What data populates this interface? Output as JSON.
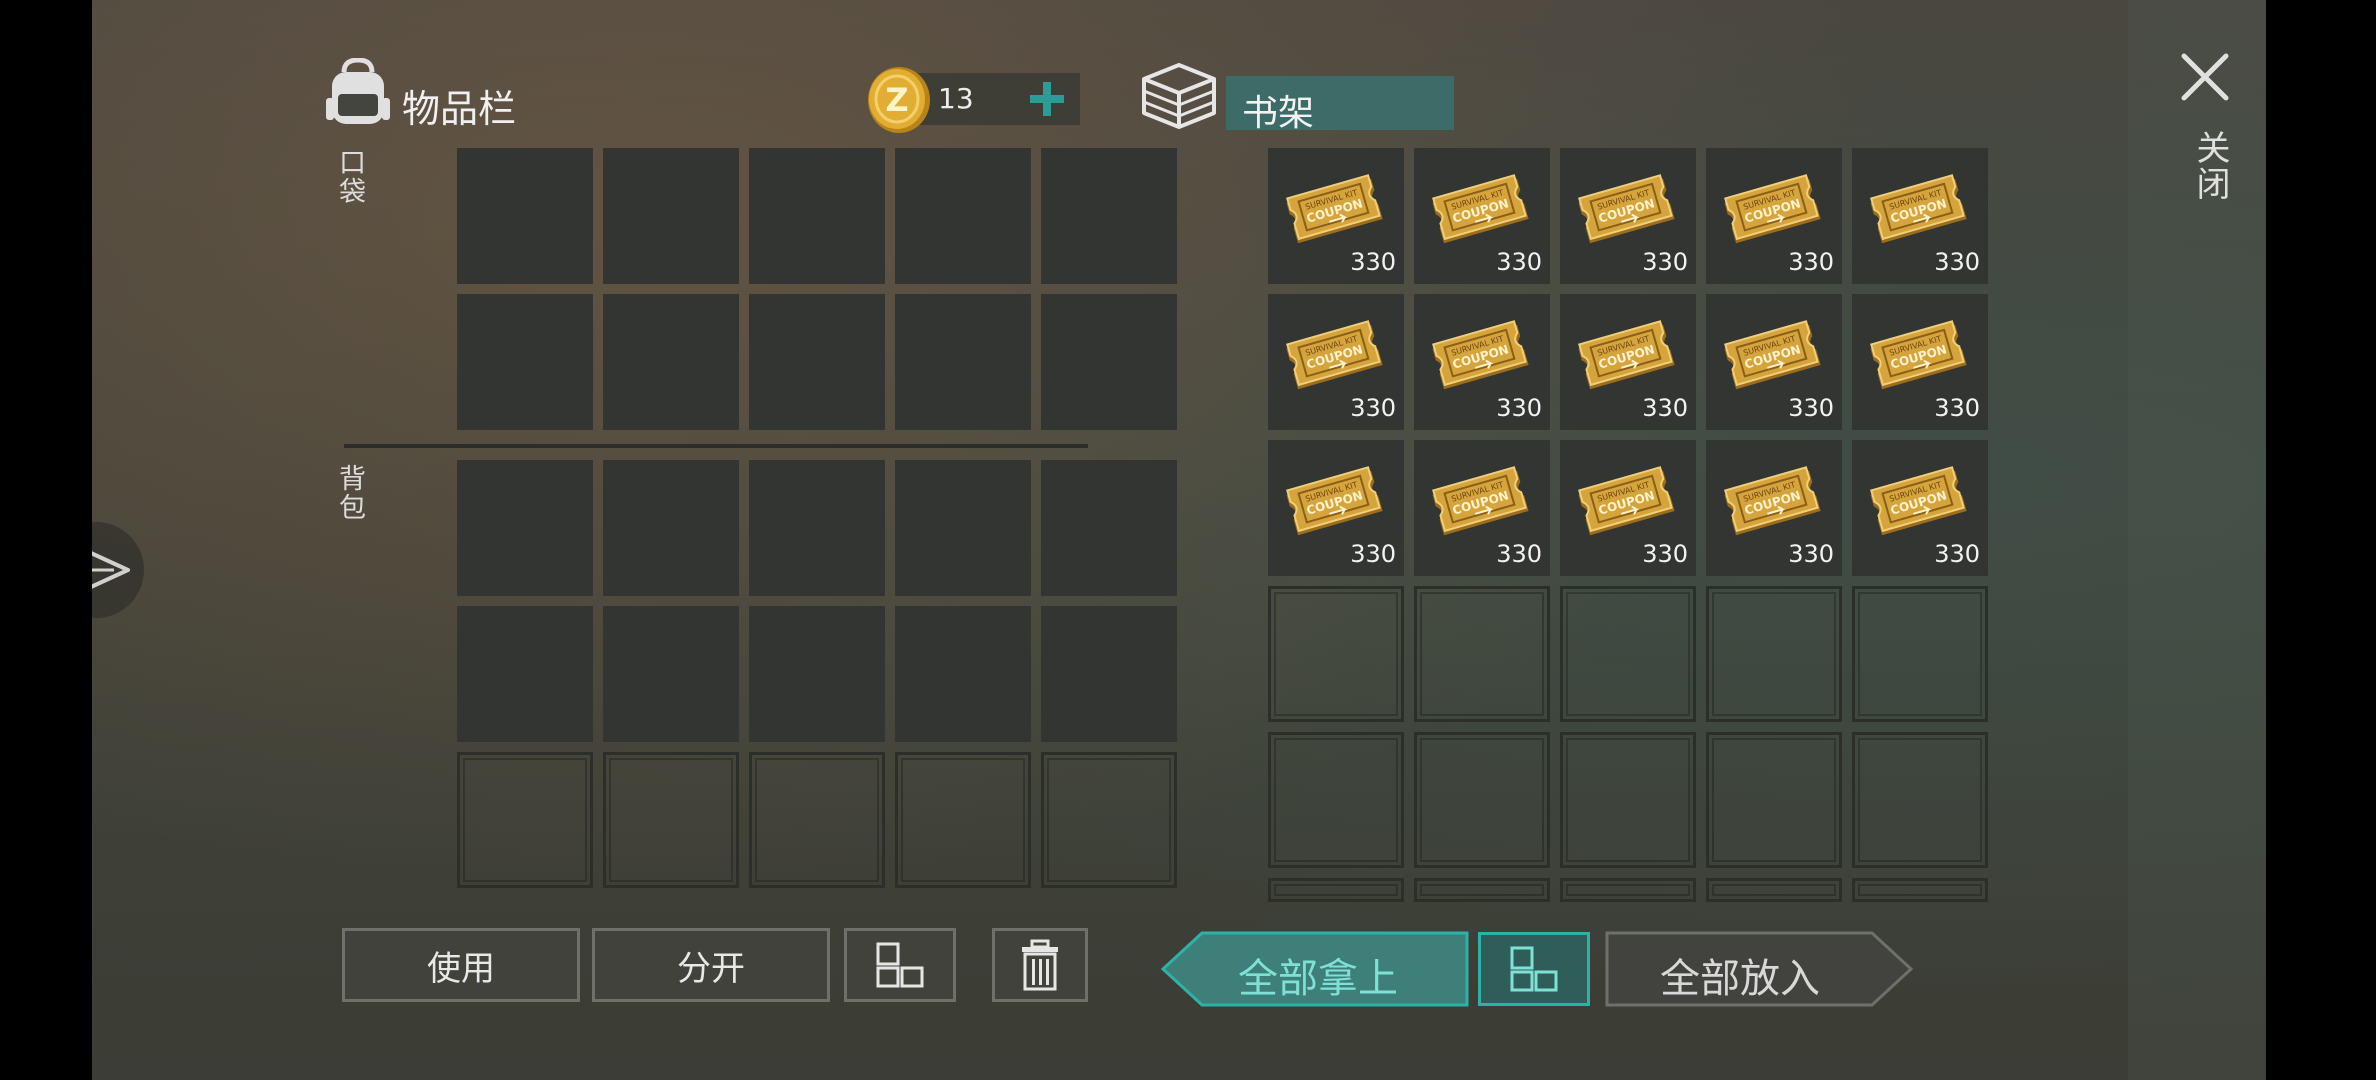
{
  "inventory": {
    "title": "物品栏",
    "pocket_label": "口袋",
    "backpack_label": "背包",
    "icon": "backpack-icon"
  },
  "currency": {
    "amount": "13",
    "icon": "gold-coin-icon",
    "add_icon": "plus-icon"
  },
  "container": {
    "title": "书架",
    "icon": "crate-icon",
    "item_name": "SURVIVAL KIT COUPON",
    "items": [
      "330",
      "330",
      "330",
      "330",
      "330",
      "330",
      "330",
      "330",
      "330",
      "330",
      "330",
      "330",
      "330",
      "330",
      "330"
    ]
  },
  "left_actions": {
    "use": "使用",
    "split": "分开",
    "sort_icon": "grid-sort-icon",
    "trash_icon": "trash-icon"
  },
  "transfer": {
    "take_all": "全部拿上",
    "put_all": "全部放入",
    "sort_icon": "grid-sort-icon"
  },
  "close": {
    "label": "关闭",
    "icon": "close-icon"
  },
  "side": {
    "icon": "send-icon"
  },
  "colors": {
    "accent": "#2c9c96",
    "accent_bg": "#3d6b68",
    "coin": "#d9a12a",
    "cell": "#333532"
  }
}
